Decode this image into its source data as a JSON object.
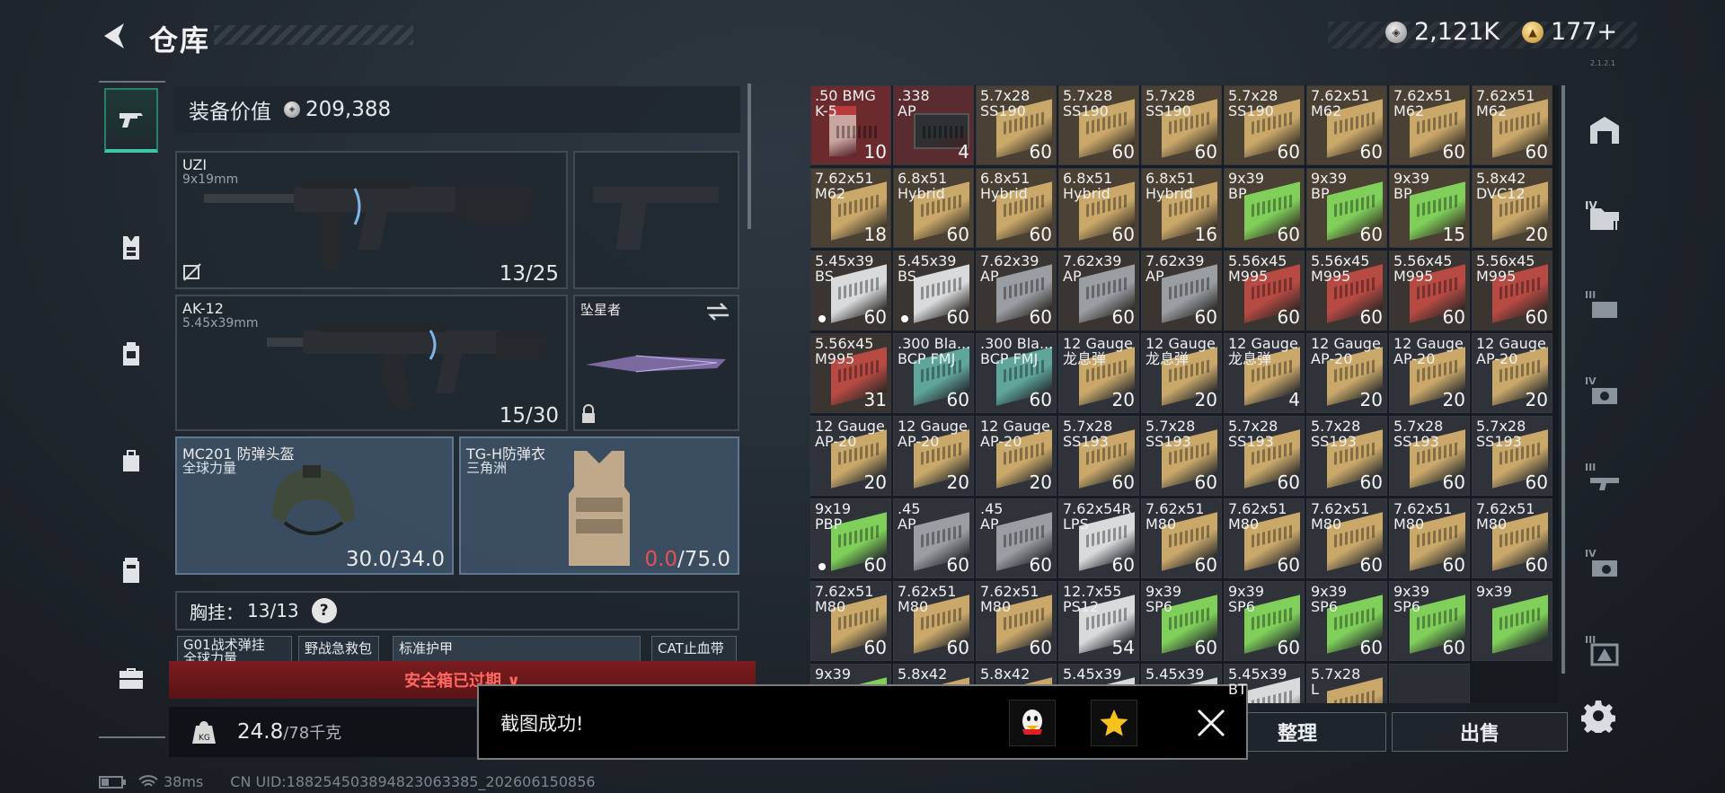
{
  "header": {
    "title": "仓库",
    "currency_silver": "2,121K",
    "currency_gold": "177+",
    "version": "2.1.2.1"
  },
  "loadout": {
    "value_label": "装备价值",
    "value": "209,388",
    "primary": {
      "name": "UZI",
      "caliber": "9x19mm",
      "ammo": "13/25"
    },
    "secondary": {
      "name": "AK-12",
      "caliber": "5.45x39mm",
      "ammo": "15/30"
    },
    "melee": {
      "name": "坠星者"
    },
    "helmet": {
      "name": "MC201 防弹头盔",
      "brand": "全球力量",
      "durability": "30.0/34.0"
    },
    "armor": {
      "name": "TG-H防弹衣",
      "brand": "三角洲",
      "durability_current": "0.0",
      "durability_max": "/75.0"
    },
    "chest": {
      "label": "胸挂：",
      "value": "13/13",
      "help": "?"
    },
    "chest_items": [
      "G01战术弹挂\n全球力量",
      "野战急救包",
      "标准护甲",
      "CAT止血带"
    ],
    "safebox_text": "安全箱已过期 ∨",
    "weight_current": "24.8",
    "weight_max": "/78千克"
  },
  "toast": {
    "message": "截图成功!"
  },
  "actions": {
    "sort": "整理",
    "sell": "出售"
  },
  "status": {
    "ping": "38ms",
    "uid": "CN UID:18825450389482306338​5_202606150856"
  },
  "colors": {
    "accent": "#3fc7a3",
    "danger": "#e25353",
    "box_tan": "#c9a86a",
    "box_green": "#7fcf5a",
    "box_red": "#b84a44",
    "box_white": "#d8dadc",
    "box_teal": "#5fa59a",
    "box_grey": "#9a9ea3"
  },
  "grid": [
    {
      "name": ".50 BMG\nK-5",
      "count": "10",
      "box": "red-pack",
      "bg": "#6b2a2e"
    },
    {
      "name": ".338\nAP",
      "count": "4",
      "box": "ammo-can",
      "bg": "#5a2c30"
    },
    {
      "name": "5.7x28\nSS190",
      "count": "60",
      "box": "box_tan",
      "bg": "#4a4033"
    },
    {
      "name": "5.7x28\nSS190",
      "count": "60",
      "box": "box_tan",
      "bg": "#4a4033"
    },
    {
      "name": "5.7x28\nSS190",
      "count": "60",
      "box": "box_tan",
      "bg": "#4a4033"
    },
    {
      "name": "5.7x28\nSS190",
      "count": "60",
      "box": "box_tan",
      "bg": "#4a4033"
    },
    {
      "name": "7.62x51\nM62",
      "count": "60",
      "box": "box_tan",
      "bg": "#4a4033"
    },
    {
      "name": "7.62x51\nM62",
      "count": "60",
      "box": "box_tan",
      "bg": "#4a4033"
    },
    {
      "name": "7.62x51\nM62",
      "count": "60",
      "box": "box_tan",
      "bg": "#4a4033"
    },
    {
      "name": "7.62x51\nM62",
      "count": "18",
      "box": "box_tan",
      "bg": "#4a4033"
    },
    {
      "name": "6.8x51\nHybrid",
      "count": "60",
      "box": "box_tan",
      "bg": "#4a4033"
    },
    {
      "name": "6.8x51\nHybrid",
      "count": "60",
      "box": "box_tan",
      "bg": "#4a4033"
    },
    {
      "name": "6.8x51\nHybrid",
      "count": "60",
      "box": "box_tan",
      "bg": "#4a4033"
    },
    {
      "name": "6.8x51\nHybrid",
      "count": "16",
      "box": "box_tan",
      "bg": "#4a4033"
    },
    {
      "name": "9x39\nBP",
      "count": "60",
      "box": "box_green",
      "bg": "#4a4033"
    },
    {
      "name": "9x39\nBP",
      "count": "60",
      "box": "box_green",
      "bg": "#4a4033"
    },
    {
      "name": "9x39\nBP",
      "count": "15",
      "box": "box_green",
      "bg": "#4a4033"
    },
    {
      "name": "5.8x42\nDVC12",
      "count": "20",
      "box": "box_tan",
      "bg": "#4a4033"
    },
    {
      "name": "5.45x39\nBS",
      "count": "60",
      "box": "box_white",
      "bg": "#3a3530",
      "dot": true
    },
    {
      "name": "5.45x39\nBS",
      "count": "60",
      "box": "box_white",
      "bg": "#3a3530",
      "dot": true
    },
    {
      "name": "7.62x39\nAP",
      "count": "60",
      "box": "box_grey",
      "bg": "#3a3530"
    },
    {
      "name": "7.62x39\nAP",
      "count": "60",
      "box": "box_grey",
      "bg": "#3a3530"
    },
    {
      "name": "7.62x39\nAP",
      "count": "60",
      "box": "box_grey",
      "bg": "#3a3530"
    },
    {
      "name": "5.56x45\nM995",
      "count": "60",
      "box": "box_red",
      "bg": "#3a3530"
    },
    {
      "name": "5.56x45\nM995",
      "count": "60",
      "box": "box_red",
      "bg": "#3a3530"
    },
    {
      "name": "5.56x45\nM995",
      "count": "60",
      "box": "box_red",
      "bg": "#3a3530"
    },
    {
      "name": "5.56x45\nM995",
      "count": "60",
      "box": "box_red",
      "bg": "#3a3530"
    },
    {
      "name": "5.56x45\nM995",
      "count": "31",
      "box": "box_red",
      "bg": "#3a3530"
    },
    {
      "name": ".300 Bla...\nBCP FMJ",
      "count": "60",
      "box": "box_teal",
      "bg": "#2f3339"
    },
    {
      "name": ".300 Bla...\nBCP FMJ",
      "count": "60",
      "box": "box_teal",
      "bg": "#2f3339"
    },
    {
      "name": "12 Gauge\n龙息弹",
      "count": "20",
      "box": "box_tan",
      "bg": "#2f3339"
    },
    {
      "name": "12 Gauge\n龙息弹",
      "count": "20",
      "box": "box_tan",
      "bg": "#2f3339"
    },
    {
      "name": "12 Gauge\n龙息弹",
      "count": "4",
      "box": "box_tan",
      "bg": "#2f3339"
    },
    {
      "name": "12 Gauge\nAP-20",
      "count": "20",
      "box": "box_tan",
      "bg": "#2f3339"
    },
    {
      "name": "12 Gauge\nAP-20",
      "count": "20",
      "box": "box_tan",
      "bg": "#2f3339"
    },
    {
      "name": "12 Gauge\nAP-20",
      "count": "20",
      "box": "box_tan",
      "bg": "#2f3339"
    },
    {
      "name": "12 Gauge\nAP-20",
      "count": "20",
      "box": "box_tan",
      "bg": "#2f3339"
    },
    {
      "name": "12 Gauge\nAP-20",
      "count": "20",
      "box": "box_tan",
      "bg": "#2f3339"
    },
    {
      "name": "12 Gauge\nAP-20",
      "count": "20",
      "box": "box_tan",
      "bg": "#2f3339"
    },
    {
      "name": "5.7x28\nSS193",
      "count": "60",
      "box": "box_tan",
      "bg": "#2f3339"
    },
    {
      "name": "5.7x28\nSS193",
      "count": "60",
      "box": "box_tan",
      "bg": "#2f3339"
    },
    {
      "name": "5.7x28\nSS193",
      "count": "60",
      "box": "box_tan",
      "bg": "#2f3339"
    },
    {
      "name": "5.7x28\nSS193",
      "count": "60",
      "box": "box_tan",
      "bg": "#2f3339"
    },
    {
      "name": "5.7x28\nSS193",
      "count": "60",
      "box": "box_tan",
      "bg": "#2f3339"
    },
    {
      "name": "5.7x28\nSS193",
      "count": "60",
      "box": "box_tan",
      "bg": "#2f3339"
    },
    {
      "name": "9x19\nPBP",
      "count": "60",
      "box": "box_green",
      "bg": "#2f3339",
      "dot": true
    },
    {
      "name": ".45\nAP",
      "count": "60",
      "box": "box_grey",
      "bg": "#2f3339"
    },
    {
      "name": ".45\nAP",
      "count": "60",
      "box": "box_grey",
      "bg": "#2f3339"
    },
    {
      "name": "7.62x54R\nLPS",
      "count": "60",
      "box": "box_white",
      "bg": "#2f3339"
    },
    {
      "name": "7.62x51\nM80",
      "count": "60",
      "box": "box_tan",
      "bg": "#2f3339"
    },
    {
      "name": "7.62x51\nM80",
      "count": "60",
      "box": "box_tan",
      "bg": "#2f3339"
    },
    {
      "name": "7.62x51\nM80",
      "count": "60",
      "box": "box_tan",
      "bg": "#2f3339"
    },
    {
      "name": "7.62x51\nM80",
      "count": "60",
      "box": "box_tan",
      "bg": "#2f3339"
    },
    {
      "name": "7.62x51\nM80",
      "count": "60",
      "box": "box_tan",
      "bg": "#2f3339"
    },
    {
      "name": "7.62x51\nM80",
      "count": "60",
      "box": "box_tan",
      "bg": "#2f3339"
    },
    {
      "name": "7.62x51\nM80",
      "count": "60",
      "box": "box_tan",
      "bg": "#2f3339"
    },
    {
      "name": "7.62x51\nM80",
      "count": "60",
      "box": "box_tan",
      "bg": "#2f3339"
    },
    {
      "name": "12.7x55\nPS12",
      "count": "54",
      "box": "box_white",
      "bg": "#2f3339"
    },
    {
      "name": "9x39\nSP6",
      "count": "60",
      "box": "box_green",
      "bg": "#2f3339"
    },
    {
      "name": "9x39\nSP6",
      "count": "60",
      "box": "box_green",
      "bg": "#2f3339"
    },
    {
      "name": "9x39\nSP6",
      "count": "60",
      "box": "box_green",
      "bg": "#2f3339"
    },
    {
      "name": "9x39\nSP6",
      "count": "60",
      "box": "box_green",
      "bg": "#2f3339"
    },
    {
      "name": "9x39",
      "count": "",
      "box": "box_green",
      "bg": "#2f3339"
    },
    {
      "name": "9x39",
      "count": "",
      "box": "box_green",
      "bg": "#2f3339"
    },
    {
      "name": "5.8x42",
      "count": "",
      "box": "box_tan",
      "bg": "#2f3339"
    },
    {
      "name": "5.8x42",
      "count": "",
      "box": "box_tan",
      "bg": "#2f3339"
    },
    {
      "name": "5.45x39",
      "count": "",
      "box": "box_white",
      "bg": "#2f3339"
    },
    {
      "name": "5.45x39",
      "count": "",
      "box": "box_white",
      "bg": "#2f3339"
    },
    {
      "name": "5.45x39\nBT",
      "count": "",
      "box": "box_white",
      "bg": "#2f3339"
    },
    {
      "name": "5.7x28\nL",
      "count": "",
      "box": "box_tan",
      "bg": "#2f3339"
    },
    {
      "name": "",
      "count": "",
      "box": "none",
      "bg": "#2a2f35"
    }
  ]
}
